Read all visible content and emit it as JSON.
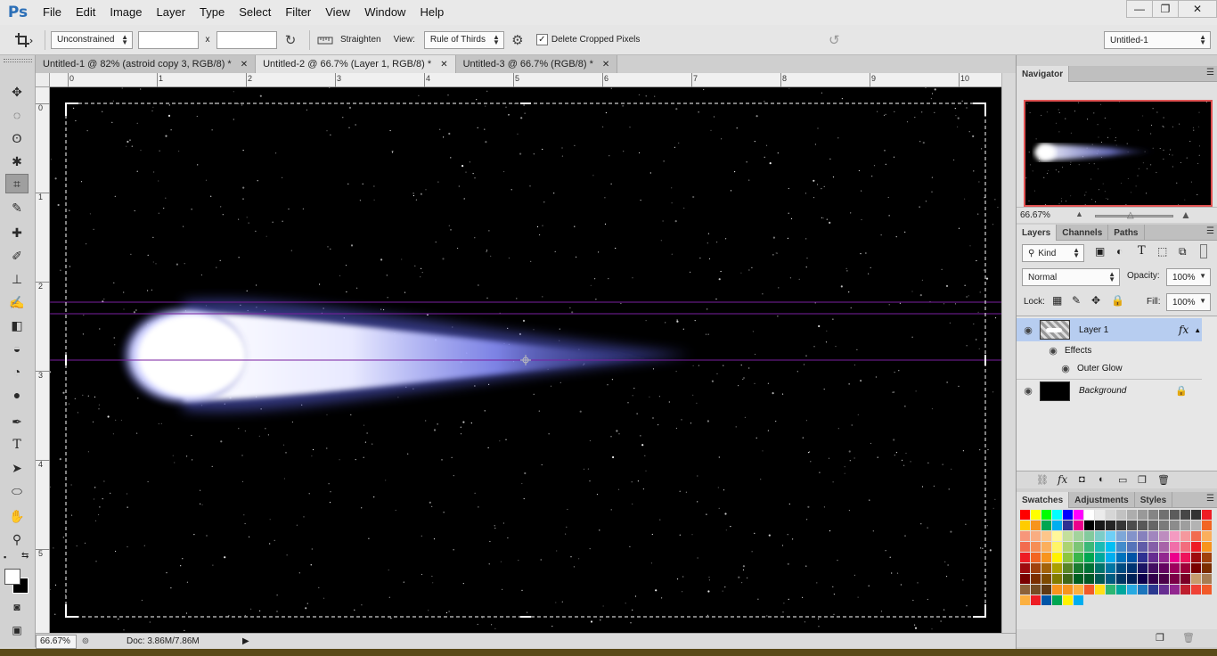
{
  "app": {
    "logo": "Ps",
    "menu": [
      "File",
      "Edit",
      "Image",
      "Layer",
      "Type",
      "Select",
      "Filter",
      "View",
      "Window",
      "Help"
    ],
    "window_controls": {
      "minimize": "—",
      "restore": "❐",
      "close": "✕"
    }
  },
  "options": {
    "ratio": "Unconstrained",
    "width_value": "",
    "height_value": "",
    "by_separator": "x",
    "straighten_label": "Straighten",
    "view_label": "View:",
    "view_value": "Rule of Thirds",
    "delete_cropped_label": "Delete Cropped Pixels",
    "delete_cropped_checked": true,
    "workspace": "Untitled-1"
  },
  "tabs": [
    {
      "label": "Untitled-1 @ 82% (astroid copy 3, RGB/8) *",
      "active": false
    },
    {
      "label": "Untitled-2 @ 66.7% (Layer 1, RGB/8) *",
      "active": true
    },
    {
      "label": "Untitled-3 @ 66.7% (RGB/8) *",
      "active": false
    }
  ],
  "ruler": {
    "h_labels": [
      "0",
      "1",
      "2",
      "3",
      "4",
      "5",
      "6",
      "7",
      "8",
      "9",
      "10"
    ],
    "v_labels": [
      "0",
      "1",
      "2",
      "3",
      "4",
      "5"
    ]
  },
  "status": {
    "zoom": "66.67%",
    "doc": "Doc: 3.86M/7.86M"
  },
  "navigator": {
    "title": "Navigator",
    "zoom": "66.67%"
  },
  "layers_panel": {
    "tabs": [
      "Layers",
      "Channels",
      "Paths"
    ],
    "filter_kind": "Kind",
    "blend_mode": "Normal",
    "opacity_label": "Opacity:",
    "opacity": "100%",
    "lock_label": "Lock:",
    "fill_label": "Fill:",
    "fill": "100%",
    "layers": [
      {
        "name": "Layer 1",
        "selected": true,
        "fx": "fx"
      },
      {
        "name": "Effects"
      },
      {
        "name": "Outer Glow"
      },
      {
        "name": "Background",
        "italic": true
      }
    ]
  },
  "swatches_panel": {
    "tabs": [
      "Swatches",
      "Adjustments",
      "Styles"
    ]
  },
  "colors": {
    "accent": "#2c6fb7",
    "selected_layer": "#b7cdf0",
    "canvas": "#000000",
    "comet_glow": "#8f96ff"
  }
}
